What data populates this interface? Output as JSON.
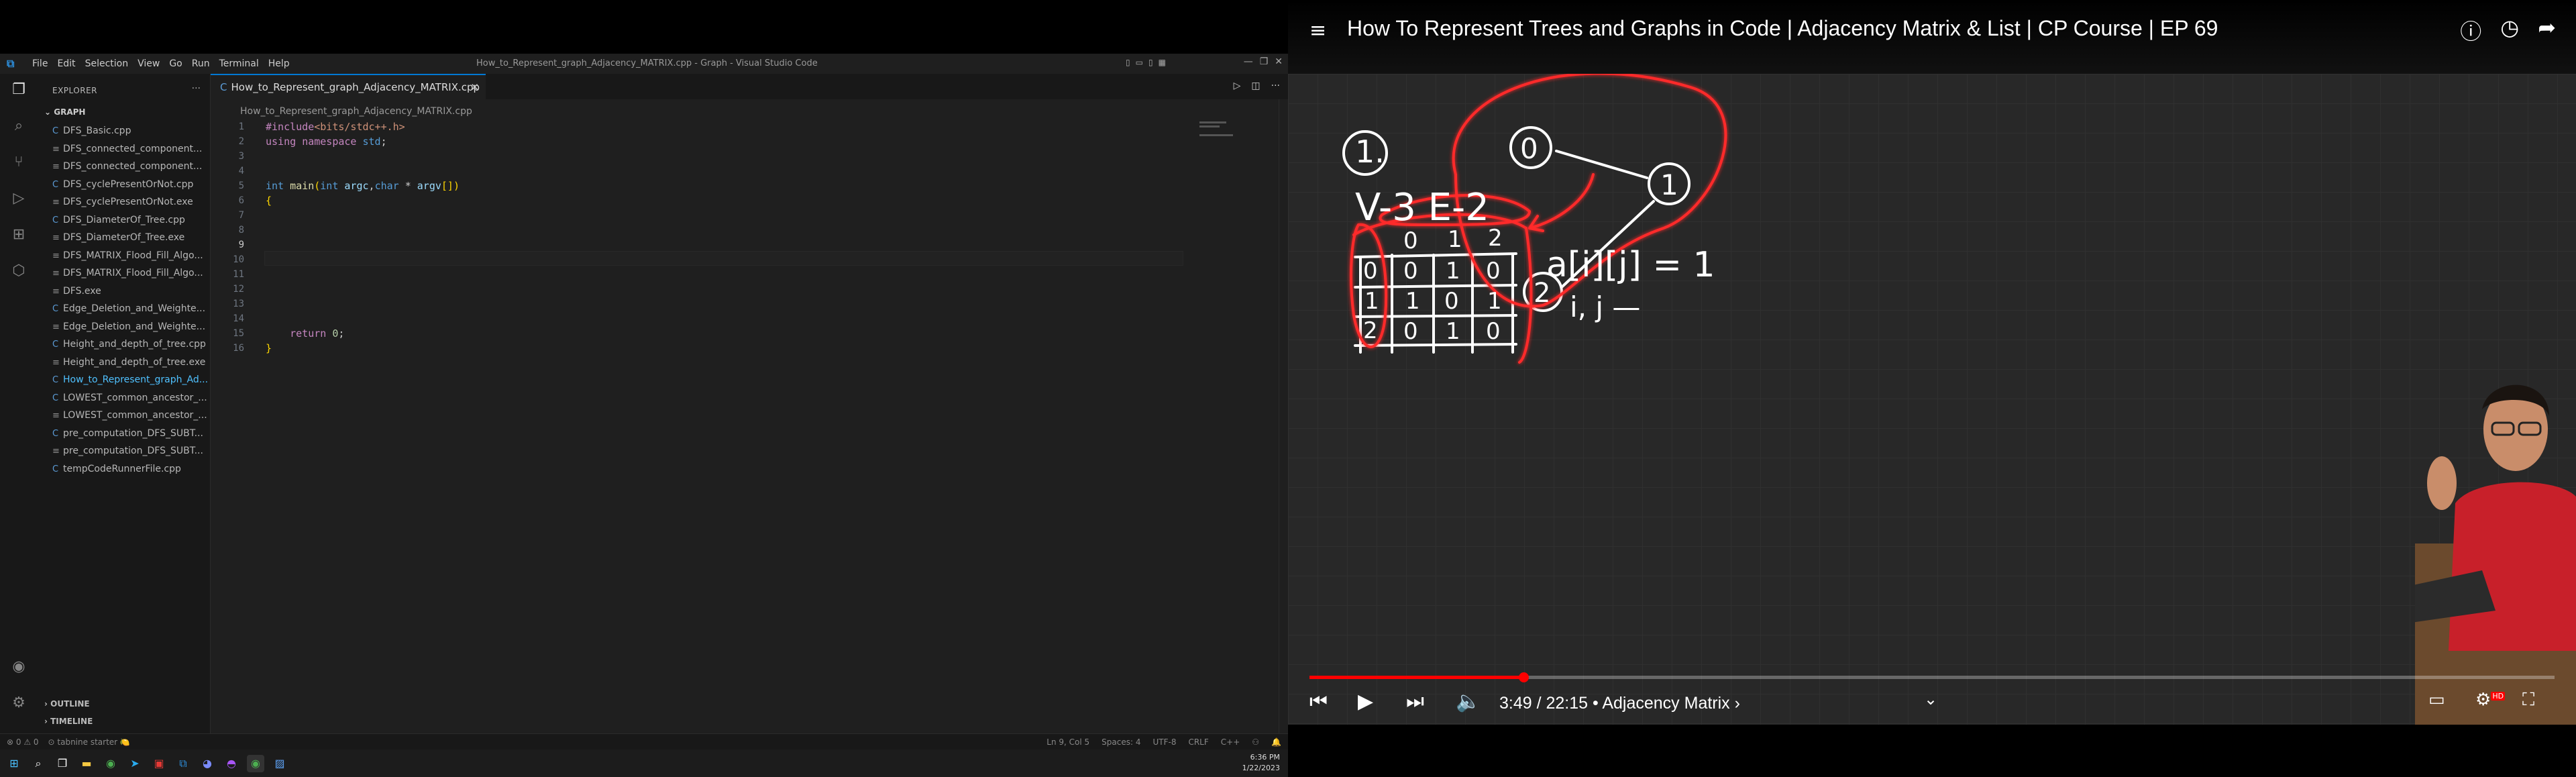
{
  "vscode": {
    "menu": [
      "File",
      "Edit",
      "Selection",
      "View",
      "Go",
      "Run",
      "Terminal",
      "Help"
    ],
    "window_title": "How_to_Represent_graph_Adjacency_MATRIX.cpp - Graph - Visual Studio Code",
    "explorer_label": "EXPLORER",
    "folder_name": "GRAPH",
    "files": [
      {
        "name": "DFS_Basic.cpp",
        "type": "cpp"
      },
      {
        "name": "DFS_connected_component...",
        "type": "exe"
      },
      {
        "name": "DFS_connected_component...",
        "type": "exe"
      },
      {
        "name": "DFS_cyclePresentOrNot.cpp",
        "type": "cpp"
      },
      {
        "name": "DFS_cyclePresentOrNot.exe",
        "type": "exe"
      },
      {
        "name": "DFS_DiameterOf_Tree.cpp",
        "type": "cpp"
      },
      {
        "name": "DFS_DiameterOf_Tree.exe",
        "type": "exe"
      },
      {
        "name": "DFS_MATRIX_Flood_Fill_Algo...",
        "type": "exe"
      },
      {
        "name": "DFS_MATRIX_Flood_Fill_Algo...",
        "type": "exe"
      },
      {
        "name": "DFS.exe",
        "type": "exe"
      },
      {
        "name": "Edge_Deletion_and_Weighte...",
        "type": "cpp"
      },
      {
        "name": "Edge_Deletion_and_Weighte...",
        "type": "exe"
      },
      {
        "name": "Height_and_depth_of_tree.cpp",
        "type": "cpp"
      },
      {
        "name": "Height_and_depth_of_tree.exe",
        "type": "exe"
      },
      {
        "name": "How_to_Represent_graph_Ad...",
        "type": "cpp",
        "active": true
      },
      {
        "name": "LOWEST_common_ancestor_...",
        "type": "cpp"
      },
      {
        "name": "LOWEST_common_ancestor_...",
        "type": "exe"
      },
      {
        "name": "pre_computation_DFS_SUBT...",
        "type": "cpp"
      },
      {
        "name": "pre_computation_DFS_SUBT...",
        "type": "exe"
      },
      {
        "name": "tempCodeRunnerFile.cpp",
        "type": "cpp"
      }
    ],
    "outline_label": "OUTLINE",
    "timeline_label": "TIMELINE",
    "tab_label": "How_to_Represent_graph_Adjacency_MATRIX.cpp",
    "breadcrumb": "How_to_Represent_graph_Adjacency_MATRIX.cpp",
    "code_lines": [
      "#include<bits/stdc++.h>",
      "using namespace std;",
      "",
      "",
      "int main(int argc,char * argv[])",
      "{",
      "",
      "",
      "",
      "",
      "",
      "",
      "    return 0;",
      "}"
    ],
    "line_numbers": [
      "1",
      "2",
      "3",
      "4",
      "5",
      "6",
      "7",
      "8",
      "9",
      "10",
      "11",
      "12",
      "13",
      "14",
      "15",
      "16"
    ],
    "current_line": "9",
    "status_left": [
      "⊗ 0 ⚠ 0",
      "⊙ tabnine starter 🍋"
    ],
    "status_right": [
      "Ln 9, Col 5",
      "Spaces: 4",
      "UTF-8",
      "CRLF",
      "C++",
      "⚇",
      "🔔"
    ],
    "clock_time": "6:36 PM",
    "clock_date": "1/22/2023"
  },
  "youtube": {
    "title": "How To Represent Trees and Graphs in Code | Adjacency Matrix & List | CP Course | EP 69",
    "time": "3:49 / 22:15",
    "chapter": "Adjacency Matrix ›",
    "progress": 0.172,
    "accent_color": "#ff0000",
    "hd_badge": "HD"
  },
  "board": {
    "circled_num": "1.",
    "nodes": [
      "0",
      "1",
      "2"
    ],
    "ve_text": "V-3  E-2",
    "col_headers": [
      "0",
      "1",
      "2"
    ],
    "row_headers": [
      "0",
      "1",
      "2"
    ],
    "matrix": [
      [
        "0",
        "1",
        "0"
      ],
      [
        "1",
        "0",
        "1"
      ],
      [
        "0",
        "1",
        "0"
      ]
    ],
    "formula": "a[i][j] = 1",
    "formula2": "i, j —"
  }
}
